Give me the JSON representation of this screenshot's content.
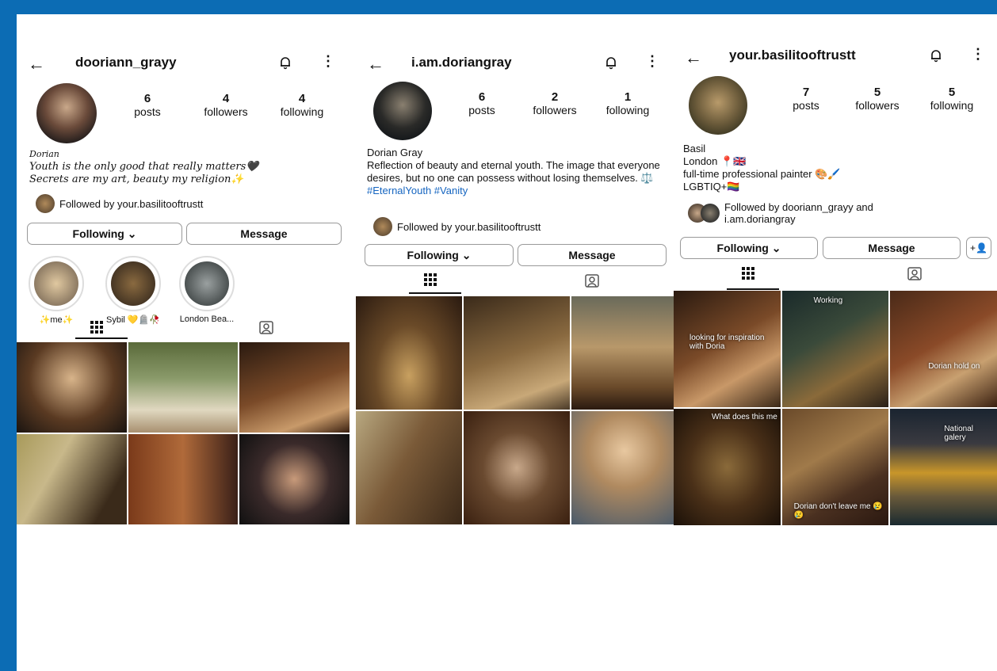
{
  "profiles": [
    {
      "username": "dooriann_grayy",
      "stats": [
        {
          "number": "6",
          "label": "posts"
        },
        {
          "number": "4",
          "label": "followers"
        },
        {
          "number": "4",
          "label": "following"
        }
      ],
      "bio_name": "Dorian",
      "bio_lines": [
        "Youth is the only good that really matters🖤",
        "Secrets are my art, beauty my religion✨"
      ],
      "followed_by": "Followed by your.basilitooftrustt",
      "follow_button": "Following ⌄",
      "message_button": "Message",
      "highlights": [
        {
          "label": "✨me✨"
        },
        {
          "label": "Sybil 💛🪦🥀"
        },
        {
          "label": "London Bea..."
        }
      ],
      "grid_colors": [
        "#4a3622",
        "#7a8a5a",
        "#5a3a20",
        "#8a7a4a",
        "#6a3a2a",
        "#2a2a2a"
      ]
    },
    {
      "username": "i.am.doriangray",
      "stats": [
        {
          "number": "6",
          "label": "posts"
        },
        {
          "number": "2",
          "label": "followers"
        },
        {
          "number": "1",
          "label": "following"
        }
      ],
      "bio_name": "Dorian Gray",
      "bio_text": "Reflection of beauty and eternal youth. The image that everyone desires, but no one can possess without losing themselves. ⚖️",
      "hashtags": "#EternalYouth #Vanity",
      "followed_by": "Followed by your.basilitooftrustt",
      "follow_button": "Following ⌄",
      "message_button": "Message",
      "grid_colors": [
        "#5a4028",
        "#4a3a28",
        "#6a5a40",
        "#7a6040",
        "#5a4a3a",
        "#8a7050"
      ]
    },
    {
      "username": "your.basilitooftrustt",
      "stats": [
        {
          "number": "7",
          "label": "posts"
        },
        {
          "number": "5",
          "label": "followers"
        },
        {
          "number": "5",
          "label": "following"
        }
      ],
      "bio_name": "Basil",
      "bio_lines": [
        "London 📍🇬🇧",
        "full-time professional painter 🎨🖌️",
        "LGBTIQ+🏳️‍🌈"
      ],
      "followed_by": "Followed by dooriann_grayy and i.am.doriangray",
      "follow_button": "Following ⌄",
      "message_button": "Message",
      "add_person_button": "+👤",
      "grid_captions": [
        "looking for inspiration with Doria",
        "Working",
        "Dorian hold on",
        "What does this me",
        "Dorian don't leave me 😢😢",
        "National galery"
      ],
      "grid_colors": [
        "#5a3a20",
        "#2a3a3a",
        "#5a3020",
        "#4a3a20",
        "#4a3a2a",
        "#3a3020"
      ]
    }
  ]
}
